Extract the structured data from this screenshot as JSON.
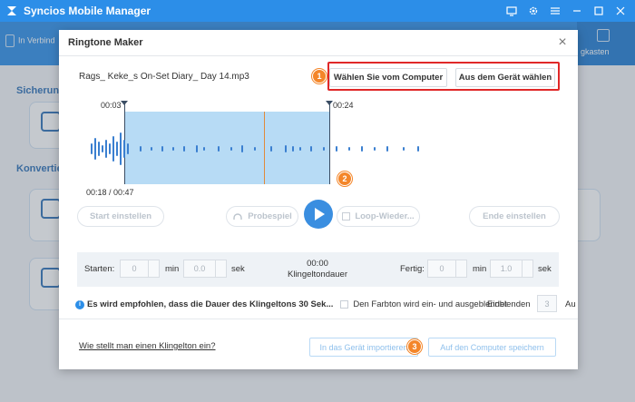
{
  "app": {
    "title": "Syncios Mobile Manager",
    "accent": "#2c8ee8",
    "window_controls": [
      "monitor-icon",
      "gear-icon",
      "menu-icon",
      "minimize-icon",
      "maximize-icon",
      "close-icon"
    ]
  },
  "background": {
    "device_label": "In Verbind",
    "right_nav_label": "gkasten",
    "sections": [
      "Sicherung",
      "Konvertier"
    ]
  },
  "dialog": {
    "title": "Ringtone Maker",
    "file_name": "Rags_ Keke_s On-Set Diary_ Day 14.mp3",
    "choose_from_computer": "Wählen Sie vom Computer",
    "choose_from_device": "Aus dem Gerät wählen",
    "badges": [
      "1",
      "2",
      "3"
    ],
    "highlight_color": "#e02828",
    "badge_color": "#f4862a",
    "waveform": {
      "start_time": "00:03",
      "end_time": "00:24",
      "position": "00:18 / 00:47"
    },
    "controls": {
      "set_start": "Start einstellen",
      "preview": "Probespiel",
      "loop": "Loop-Wieder...",
      "set_end": "Ende einstellen"
    },
    "timing": {
      "start_label": "Starten:",
      "start_min": "0",
      "min_unit": "min",
      "start_sec": "0.0",
      "sec_unit": "sek",
      "duration_value": "00:00",
      "duration_label": "Klingeltondauer",
      "end_label": "Fertig:",
      "end_min": "0",
      "end_sec": "1.0"
    },
    "recommend": {
      "text": "Es wird empfohlen, dass die Dauer des Klingeltons 30 Sek...",
      "fade_label": "Den Farbton wird ein- und ausgeblendet",
      "fade_in_label": "Einblenden",
      "fade_in_value": "3",
      "cut_label": "Au"
    },
    "footer": {
      "howto": "Wie stellt man einen Klingelton ein?",
      "import_device": "In das Gerät importieren",
      "save_computer": "Auf den Computer speichern"
    }
  }
}
